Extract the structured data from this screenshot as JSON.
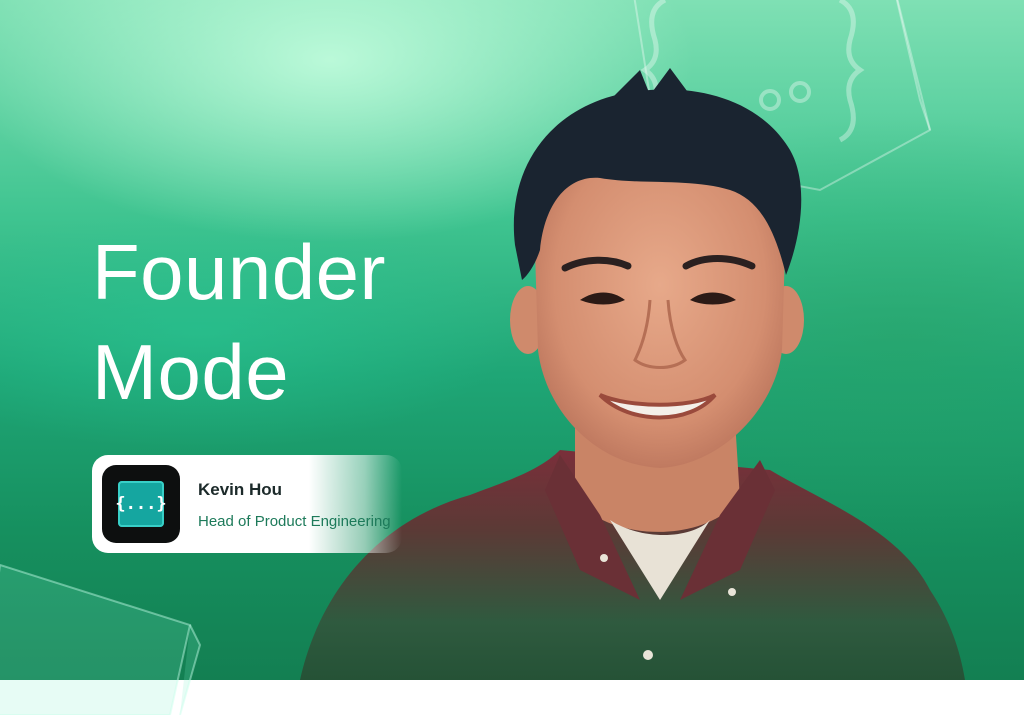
{
  "headline": {
    "line1": "Founder",
    "line2": "Mode"
  },
  "profile": {
    "name": "Kevin Hou",
    "role": "Head of Product Engineering",
    "logo_glyph": "{...}"
  },
  "colors": {
    "background_light": "#7fe0b4",
    "background_dark": "#137f52",
    "logo_accent": "#15a6a0",
    "role_text": "#1d7a5a"
  },
  "icons": [
    "code-braces-key-icon",
    "app-logo-icon"
  ]
}
